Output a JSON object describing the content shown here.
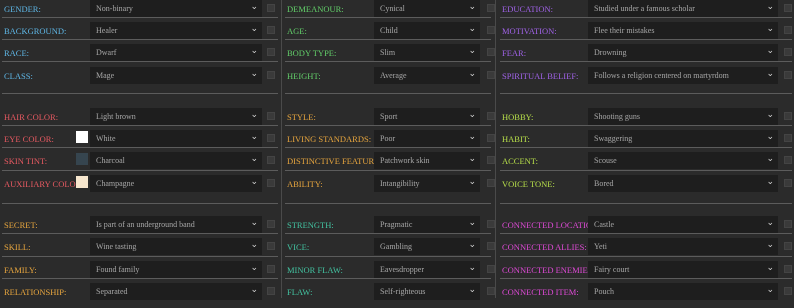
{
  "colors": {
    "blue": "#5fb8e8",
    "green": "#63d06a",
    "purple": "#a062e8",
    "red": "#e85a62",
    "orange": "#e8a63e",
    "teal": "#43c4a2",
    "yellowgreen": "#b8e04a",
    "magenta": "#e04ad8"
  },
  "column1": {
    "rows": [
      {
        "label": "GENDER:",
        "value": "Non-binary",
        "color": "#5fb8e8"
      },
      {
        "label": "BACKGROUND:",
        "value": "Healer",
        "color": "#5fb8e8"
      },
      {
        "label": "RACE:",
        "value": "Dwarf",
        "color": "#5fb8e8"
      },
      {
        "label": "CLASS:",
        "value": "Mage",
        "color": "#5fb8e8"
      },
      {
        "label": "HAIR COLOR:",
        "value": "Light brown",
        "color": "#e85a62"
      },
      {
        "label": "EYE COLOR:",
        "value": "White",
        "color": "#e85a62",
        "swatch": "#ffffff"
      },
      {
        "label": "SKIN TINT:",
        "value": "Charcoal",
        "color": "#e85a62",
        "swatch": "#36454f"
      },
      {
        "label": "AUXILIARY COLOR:",
        "value": "Champagne",
        "color": "#e85a62",
        "swatch": "#f7e7ce"
      },
      {
        "label": "SECRET:",
        "value": "Is part of an underground band",
        "color": "#e8a63e"
      },
      {
        "label": "SKILL:",
        "value": "Wine tasting",
        "color": "#e8a63e"
      },
      {
        "label": "FAMILY:",
        "value": "Found family",
        "color": "#e8a63e"
      },
      {
        "label": "RELATIONSHIP:",
        "value": "Separated",
        "color": "#e8a63e"
      }
    ]
  },
  "column2": {
    "rows": [
      {
        "label": "DEMEANOUR:",
        "value": "Cynical",
        "color": "#63d06a"
      },
      {
        "label": "AGE:",
        "value": "Child",
        "color": "#63d06a"
      },
      {
        "label": "BODY TYPE:",
        "value": "Slim",
        "color": "#63d06a"
      },
      {
        "label": "HEIGHT:",
        "value": "Average",
        "color": "#63d06a"
      },
      {
        "label": "STYLE:",
        "value": "Sport",
        "color": "#e8a63e"
      },
      {
        "label": "LIVING STANDARDS:",
        "value": "Poor",
        "color": "#e8a63e"
      },
      {
        "label": "DISTINCTIVE FEATURE:",
        "value": "Patchwork skin",
        "color": "#e8a63e"
      },
      {
        "label": "ABILITY:",
        "value": "Intangibility",
        "color": "#e8a63e"
      },
      {
        "label": "STRENGTH:",
        "value": "Pragmatic",
        "color": "#43c4a2"
      },
      {
        "label": "VICE:",
        "value": "Gambling",
        "color": "#43c4a2"
      },
      {
        "label": "MINOR FLAW:",
        "value": "Eavesdropper",
        "color": "#43c4a2"
      },
      {
        "label": "FLAW:",
        "value": "Self-righteous",
        "color": "#43c4a2"
      }
    ]
  },
  "column3": {
    "rows": [
      {
        "label": "EDUCATION:",
        "value": "Studied under a famous scholar",
        "color": "#a062e8"
      },
      {
        "label": "MOTIVATION:",
        "value": "Flee their mistakes",
        "color": "#a062e8"
      },
      {
        "label": "FEAR:",
        "value": "Drowning",
        "color": "#a062e8"
      },
      {
        "label": "SPIRITUAL BELIEF:",
        "value": "Follows a religion centered on martyrdom",
        "color": "#a062e8"
      },
      {
        "label": "HOBBY:",
        "value": "Shooting guns",
        "color": "#b8e04a"
      },
      {
        "label": "HABIT:",
        "value": "Swaggering",
        "color": "#b8e04a"
      },
      {
        "label": "ACCENT:",
        "value": "Scouse",
        "color": "#b8e04a"
      },
      {
        "label": "VOICE TONE:",
        "value": "Bored",
        "color": "#b8e04a"
      },
      {
        "label": "CONNECTED LOCATION:",
        "value": "Castle",
        "color": "#e04ad8"
      },
      {
        "label": "CONNECTED ALLIES:",
        "value": "Yeti",
        "color": "#e04ad8"
      },
      {
        "label": "CONNECTED ENEMIES:",
        "value": "Fairy court",
        "color": "#e04ad8"
      },
      {
        "label": "CONNECTED ITEM:",
        "value": "Pouch",
        "color": "#e04ad8"
      }
    ]
  }
}
